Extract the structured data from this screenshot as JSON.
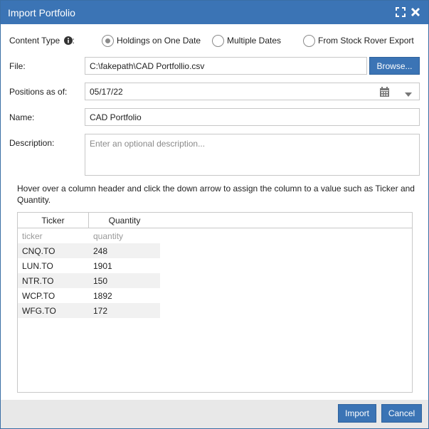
{
  "window": {
    "title": "Import Portfolio"
  },
  "content_type": {
    "label": "Content Type",
    "options": [
      {
        "label": "Holdings on One Date",
        "selected": true
      },
      {
        "label": "Multiple Dates",
        "selected": false
      },
      {
        "label": "From Stock Rover Export",
        "selected": false
      }
    ]
  },
  "file": {
    "label": "File:",
    "value": "C:\\fakepath\\CAD Portfollio.csv",
    "browse_label": "Browse..."
  },
  "positions": {
    "label": "Positions as of:",
    "value": "05/17/22"
  },
  "name": {
    "label": "Name:",
    "value": "CAD Portfolio"
  },
  "description": {
    "label": "Description:",
    "placeholder": "Enter an optional description..."
  },
  "hint": "Hover over a column header and click the down arrow to assign the column to a value such as Ticker and Quantity.",
  "grid": {
    "headers": [
      "Ticker",
      "Quantity"
    ],
    "rows": [
      [
        "ticker",
        "quantity"
      ],
      [
        "CNQ.TO",
        "248"
      ],
      [
        "LUN.TO",
        "1901"
      ],
      [
        "NTR.TO",
        "150"
      ],
      [
        "WCP.TO",
        "1892"
      ],
      [
        "WFG.TO",
        "172"
      ]
    ]
  },
  "footer": {
    "import_label": "Import",
    "cancel_label": "Cancel"
  },
  "colors": {
    "accent": "#3b74b5",
    "footer": "#e8e8e8"
  },
  "icons": [
    "maximize-icon",
    "close-icon",
    "info-icon",
    "calendar-icon",
    "chevron-down-icon"
  ]
}
